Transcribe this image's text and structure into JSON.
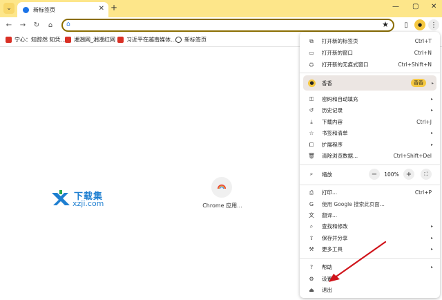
{
  "browser": {
    "tab_title": "新标签页",
    "new_tab_label": "+",
    "tab_close_glyph": "✕",
    "window_controls": {
      "minimize": "—",
      "maximize": "▢",
      "close": "✕"
    }
  },
  "toolbar": {
    "back_glyph": "←",
    "forward_glyph": "→",
    "reload_glyph": "↻",
    "home_glyph": "⌂",
    "address_icon": "⌂",
    "bookmark_star_glyph": "★",
    "side_panel_glyph": "▯",
    "profile_glyph": "●",
    "menu_glyph": "⋮"
  },
  "bookmarks": [
    {
      "label": "宁心：知踪然 知凭...",
      "icon_color": "#d93025"
    },
    {
      "label": "湘潮网_湘潮红网",
      "icon_color": "#d93025"
    },
    {
      "label": "习近平在越南媒体...",
      "icon_color": "#d93025"
    },
    {
      "label": "新标签页",
      "icon_color": "#333333"
    }
  ],
  "newtab": {
    "logo_text_cn": "下载集",
    "logo_text_en": "xzji.com",
    "shortcut_label": "Chrome 应用..."
  },
  "menu": {
    "group1": [
      {
        "icon": "⧉",
        "icon_name": "new-tab-icon",
        "label": "打开新的标签页",
        "shortcut": "Ctrl+T"
      },
      {
        "icon": "▭",
        "icon_name": "new-window-icon",
        "label": "打开新的窗口",
        "shortcut": "Ctrl+N"
      },
      {
        "icon": "⛭",
        "icon_name": "incognito-icon",
        "label": "打开新的无痕式窗口",
        "shortcut": "Ctrl+Shift+N"
      }
    ],
    "profile": {
      "name": "香香",
      "chip": "香香",
      "arrow": "▸"
    },
    "group2": [
      {
        "icon": "⚿",
        "icon_name": "key-icon",
        "label": "密码和自动填充",
        "shortcut": "",
        "arrow": "▸"
      },
      {
        "icon": "↺",
        "icon_name": "history-icon",
        "label": "历史记录",
        "shortcut": "",
        "arrow": "▸"
      },
      {
        "icon": "⤓",
        "icon_name": "download-icon",
        "label": "下载内容",
        "shortcut": "Ctrl+J",
        "arrow": ""
      },
      {
        "icon": "☆",
        "icon_name": "bookmark-icon",
        "label": "书签和清单",
        "shortcut": "",
        "arrow": "▸"
      },
      {
        "icon": "⧠",
        "icon_name": "extensions-icon",
        "label": "扩展程序",
        "shortcut": "",
        "arrow": "▸"
      },
      {
        "icon": "🗑",
        "icon_name": "trash-icon",
        "label": "清除浏览数据...",
        "shortcut": "Ctrl+Shift+Del",
        "arrow": ""
      }
    ],
    "zoom": {
      "icon": "⌕",
      "label": "缩放",
      "minus": "−",
      "value": "100%",
      "plus": "+",
      "fullscreen": "⛶"
    },
    "group3": [
      {
        "icon": "⎙",
        "icon_name": "print-icon",
        "label": "打印...",
        "shortcut": "Ctrl+P",
        "arrow": ""
      },
      {
        "icon": "G",
        "icon_name": "google-icon",
        "label": "使用 Google 搜索此页面...",
        "shortcut": "",
        "arrow": ""
      },
      {
        "icon": "文",
        "icon_name": "translate-icon",
        "label": "翻译...",
        "shortcut": "",
        "arrow": ""
      },
      {
        "icon": "⌕",
        "icon_name": "find-icon",
        "label": "查找和修改",
        "shortcut": "",
        "arrow": "▸"
      },
      {
        "icon": "⇪",
        "icon_name": "save-share-icon",
        "label": "保存并分享",
        "shortcut": "",
        "arrow": "▸"
      },
      {
        "icon": "⚒",
        "icon_name": "tools-icon",
        "label": "更多工具",
        "shortcut": "",
        "arrow": "▸"
      }
    ],
    "group4": [
      {
        "icon": "?",
        "icon_name": "help-icon",
        "label": "帮助",
        "shortcut": "",
        "arrow": "▸"
      },
      {
        "icon": "⚙",
        "icon_name": "settings-icon",
        "label": "设置",
        "shortcut": "",
        "arrow": ""
      },
      {
        "icon": "⏏",
        "icon_name": "exit-icon",
        "label": "退出",
        "shortcut": "",
        "arrow": ""
      }
    ]
  },
  "colors": {
    "tabstrip": "#fde68a",
    "accent": "#8a6d00",
    "annotation_arrow": "#d0141b"
  }
}
